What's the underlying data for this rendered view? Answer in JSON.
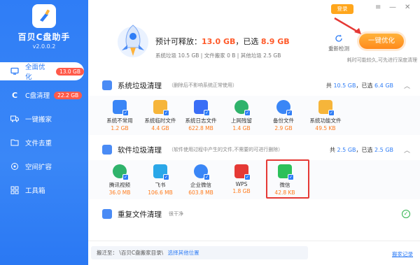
{
  "app": {
    "title": "百贝C盘助手",
    "version": "v2.0.0.2"
  },
  "colors": {
    "brand": "#2f7df6",
    "accent": "#ff8a1c",
    "size": "#ff7a1a",
    "danger": "#ff5a4a"
  },
  "sidebar": {
    "items": [
      {
        "label": "全面优化",
        "icon": "monitor-icon",
        "badge": "13.0 GB",
        "active": true
      },
      {
        "label": "C盘清理",
        "icon": "c-drive-icon",
        "badge": "22.2 GB",
        "active": false
      },
      {
        "label": "一键搬家",
        "icon": "truck-icon",
        "badge": "",
        "active": false
      },
      {
        "label": "文件去重",
        "icon": "files-icon",
        "badge": "",
        "active": false
      },
      {
        "label": "空间扩容",
        "icon": "expand-icon",
        "badge": "",
        "active": false
      },
      {
        "label": "工具箱",
        "icon": "toolbox-icon",
        "badge": "",
        "active": false
      }
    ]
  },
  "topbar": {
    "login": "登录"
  },
  "hero": {
    "title_prefix": "预计可释放：",
    "release_size": "13.0 GB",
    "selected_prefix": "，已选",
    "selected_size": "8.9 GB",
    "detail": "系统垃圾 10.5 GB | 文件搬家 0 B | 其他垃圾 2.5 GB",
    "rescan": "重新检测",
    "onekey": "一键优化",
    "hint": "耗时可能较久,可先进行深度清理"
  },
  "sections": [
    {
      "title": "系统垃圾清理",
      "desc": "（删除后不影响系统正常使用）",
      "total_label": "共",
      "total": "10.5 GB",
      "selected_label": "，已选",
      "selected": "6.4 GB",
      "items": [
        {
          "label": "系统不常用",
          "size": "1.2 GB",
          "icon": "monitor-icon",
          "color": "#3a86f6"
        },
        {
          "label": "系统临时文件",
          "size": "4.4 GB",
          "icon": "folder-icon",
          "color": "#f6b53a"
        },
        {
          "label": "系统日志文件",
          "size": "622.8 MB",
          "icon": "log-icon",
          "color": "#3a6ef6"
        },
        {
          "label": "上网残留",
          "size": "1.4 GB",
          "icon": "edge-icon",
          "color": "#2fb36b"
        },
        {
          "label": "备份文件",
          "size": "2.9 GB",
          "icon": "backup-icon",
          "color": "#3a86f6"
        },
        {
          "label": "系统功能文件",
          "size": "49.5 KB",
          "icon": "grid-icon",
          "color": "#f6b53a"
        }
      ]
    },
    {
      "title": "软件垃圾清理",
      "desc": "（软件使用过程中产生的文件,不需要的可进行删除）",
      "total_label": "共",
      "total": "2.5 GB",
      "selected_label": "，已选",
      "selected": "2.5 GB",
      "items": [
        {
          "label": "腾讯视频",
          "size": "36.0 MB",
          "icon": "tencent-video-icon",
          "color": "#2fb36b"
        },
        {
          "label": "飞书",
          "size": "106.6 MB",
          "icon": "feishu-icon",
          "color": "#2aa7e8"
        },
        {
          "label": "企业微信",
          "size": "603.8 MB",
          "icon": "wecom-icon",
          "color": "#3a86f6"
        },
        {
          "label": "WPS",
          "size": "1.8 GB",
          "icon": "wps-icon",
          "color": "#e53935"
        },
        {
          "label": "微信",
          "size": "42.8 KB",
          "icon": "wechat-icon",
          "color": "#2cc05a"
        }
      ]
    },
    {
      "title": "重复文件清理",
      "desc": "很干净"
    }
  ],
  "bottom": {
    "move_label": "搬迁至：",
    "path": "\\百贝C盘搬家目录\\",
    "choose": "选择其他位置",
    "records": "搬家记录"
  }
}
